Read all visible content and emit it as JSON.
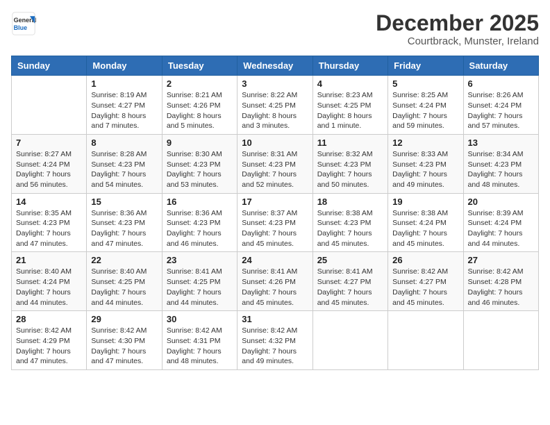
{
  "header": {
    "logo_general": "General",
    "logo_blue": "Blue",
    "month_title": "December 2025",
    "location": "Courtbrack, Munster, Ireland"
  },
  "weekdays": [
    "Sunday",
    "Monday",
    "Tuesday",
    "Wednesday",
    "Thursday",
    "Friday",
    "Saturday"
  ],
  "weeks": [
    [
      {
        "day": "",
        "info": ""
      },
      {
        "day": "1",
        "info": "Sunrise: 8:19 AM\nSunset: 4:27 PM\nDaylight: 8 hours\nand 7 minutes."
      },
      {
        "day": "2",
        "info": "Sunrise: 8:21 AM\nSunset: 4:26 PM\nDaylight: 8 hours\nand 5 minutes."
      },
      {
        "day": "3",
        "info": "Sunrise: 8:22 AM\nSunset: 4:25 PM\nDaylight: 8 hours\nand 3 minutes."
      },
      {
        "day": "4",
        "info": "Sunrise: 8:23 AM\nSunset: 4:25 PM\nDaylight: 8 hours\nand 1 minute."
      },
      {
        "day": "5",
        "info": "Sunrise: 8:25 AM\nSunset: 4:24 PM\nDaylight: 7 hours\nand 59 minutes."
      },
      {
        "day": "6",
        "info": "Sunrise: 8:26 AM\nSunset: 4:24 PM\nDaylight: 7 hours\nand 57 minutes."
      }
    ],
    [
      {
        "day": "7",
        "info": "Sunrise: 8:27 AM\nSunset: 4:24 PM\nDaylight: 7 hours\nand 56 minutes."
      },
      {
        "day": "8",
        "info": "Sunrise: 8:28 AM\nSunset: 4:23 PM\nDaylight: 7 hours\nand 54 minutes."
      },
      {
        "day": "9",
        "info": "Sunrise: 8:30 AM\nSunset: 4:23 PM\nDaylight: 7 hours\nand 53 minutes."
      },
      {
        "day": "10",
        "info": "Sunrise: 8:31 AM\nSunset: 4:23 PM\nDaylight: 7 hours\nand 52 minutes."
      },
      {
        "day": "11",
        "info": "Sunrise: 8:32 AM\nSunset: 4:23 PM\nDaylight: 7 hours\nand 50 minutes."
      },
      {
        "day": "12",
        "info": "Sunrise: 8:33 AM\nSunset: 4:23 PM\nDaylight: 7 hours\nand 49 minutes."
      },
      {
        "day": "13",
        "info": "Sunrise: 8:34 AM\nSunset: 4:23 PM\nDaylight: 7 hours\nand 48 minutes."
      }
    ],
    [
      {
        "day": "14",
        "info": "Sunrise: 8:35 AM\nSunset: 4:23 PM\nDaylight: 7 hours\nand 47 minutes."
      },
      {
        "day": "15",
        "info": "Sunrise: 8:36 AM\nSunset: 4:23 PM\nDaylight: 7 hours\nand 47 minutes."
      },
      {
        "day": "16",
        "info": "Sunrise: 8:36 AM\nSunset: 4:23 PM\nDaylight: 7 hours\nand 46 minutes."
      },
      {
        "day": "17",
        "info": "Sunrise: 8:37 AM\nSunset: 4:23 PM\nDaylight: 7 hours\nand 45 minutes."
      },
      {
        "day": "18",
        "info": "Sunrise: 8:38 AM\nSunset: 4:23 PM\nDaylight: 7 hours\nand 45 minutes."
      },
      {
        "day": "19",
        "info": "Sunrise: 8:38 AM\nSunset: 4:24 PM\nDaylight: 7 hours\nand 45 minutes."
      },
      {
        "day": "20",
        "info": "Sunrise: 8:39 AM\nSunset: 4:24 PM\nDaylight: 7 hours\nand 44 minutes."
      }
    ],
    [
      {
        "day": "21",
        "info": "Sunrise: 8:40 AM\nSunset: 4:24 PM\nDaylight: 7 hours\nand 44 minutes."
      },
      {
        "day": "22",
        "info": "Sunrise: 8:40 AM\nSunset: 4:25 PM\nDaylight: 7 hours\nand 44 minutes."
      },
      {
        "day": "23",
        "info": "Sunrise: 8:41 AM\nSunset: 4:25 PM\nDaylight: 7 hours\nand 44 minutes."
      },
      {
        "day": "24",
        "info": "Sunrise: 8:41 AM\nSunset: 4:26 PM\nDaylight: 7 hours\nand 45 minutes."
      },
      {
        "day": "25",
        "info": "Sunrise: 8:41 AM\nSunset: 4:27 PM\nDaylight: 7 hours\nand 45 minutes."
      },
      {
        "day": "26",
        "info": "Sunrise: 8:42 AM\nSunset: 4:27 PM\nDaylight: 7 hours\nand 45 minutes."
      },
      {
        "day": "27",
        "info": "Sunrise: 8:42 AM\nSunset: 4:28 PM\nDaylight: 7 hours\nand 46 minutes."
      }
    ],
    [
      {
        "day": "28",
        "info": "Sunrise: 8:42 AM\nSunset: 4:29 PM\nDaylight: 7 hours\nand 47 minutes."
      },
      {
        "day": "29",
        "info": "Sunrise: 8:42 AM\nSunset: 4:30 PM\nDaylight: 7 hours\nand 47 minutes."
      },
      {
        "day": "30",
        "info": "Sunrise: 8:42 AM\nSunset: 4:31 PM\nDaylight: 7 hours\nand 48 minutes."
      },
      {
        "day": "31",
        "info": "Sunrise: 8:42 AM\nSunset: 4:32 PM\nDaylight: 7 hours\nand 49 minutes."
      },
      {
        "day": "",
        "info": ""
      },
      {
        "day": "",
        "info": ""
      },
      {
        "day": "",
        "info": ""
      }
    ]
  ]
}
